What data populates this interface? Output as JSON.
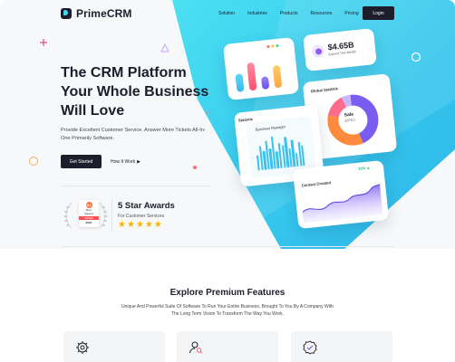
{
  "brand": {
    "name": "PrimeCRM"
  },
  "nav": {
    "links": [
      "Solution",
      "Industries",
      "Products",
      "Resources",
      "Pricing"
    ],
    "login_label": "Login"
  },
  "hero": {
    "headline_lines": [
      "The CRM Platform",
      "Your Whole Business",
      "Will Love"
    ],
    "subtext": "Provide Excellent Customer Service. Answer More Tickets All-In-One Primarily Software.",
    "primary_button": "Get Started",
    "secondary_button": "How It Work"
  },
  "award": {
    "badge_logo": "G2",
    "badge_line1": "Best",
    "badge_line2": "Support",
    "badge_ribbon": "SPRING",
    "badge_year": "2024",
    "title": "5 Star Awards",
    "subtitle": "For Customer Services",
    "rating": 5
  },
  "dashboard": {
    "earned": {
      "amount": "$4.65B",
      "label": "Earned This Month"
    },
    "global_statistic": {
      "title": "Global Statistic",
      "center_label": "Sale",
      "center_value": "£978.1"
    },
    "statistic": {
      "title": "Statistic",
      "chart_title": "Business Manager",
      "bars": [
        0.45,
        0.7,
        0.55,
        0.85,
        0.6,
        0.95,
        0.5,
        0.75,
        0.65,
        0.9,
        0.55,
        0.8,
        0.4,
        0.7,
        0.6
      ]
    },
    "contact": {
      "title": "Contact Created",
      "growth": "12% ▲"
    },
    "mini_bars": [
      0.55,
      0.85,
      0.4,
      0.7
    ]
  },
  "features": {
    "title": "Explore Premium Features",
    "subtitle": "Unique And Powerful Suite Of Software To Run Your Entire Business, Brought To You By A Company With The Long Term Vision To Transform The Way You Work."
  },
  "colors": {
    "dark": "#1d1d2b",
    "cyan": "#35c8ee",
    "purple": "#7b5cf0",
    "orange": "#ff8a3d",
    "star": "#f7b500"
  }
}
